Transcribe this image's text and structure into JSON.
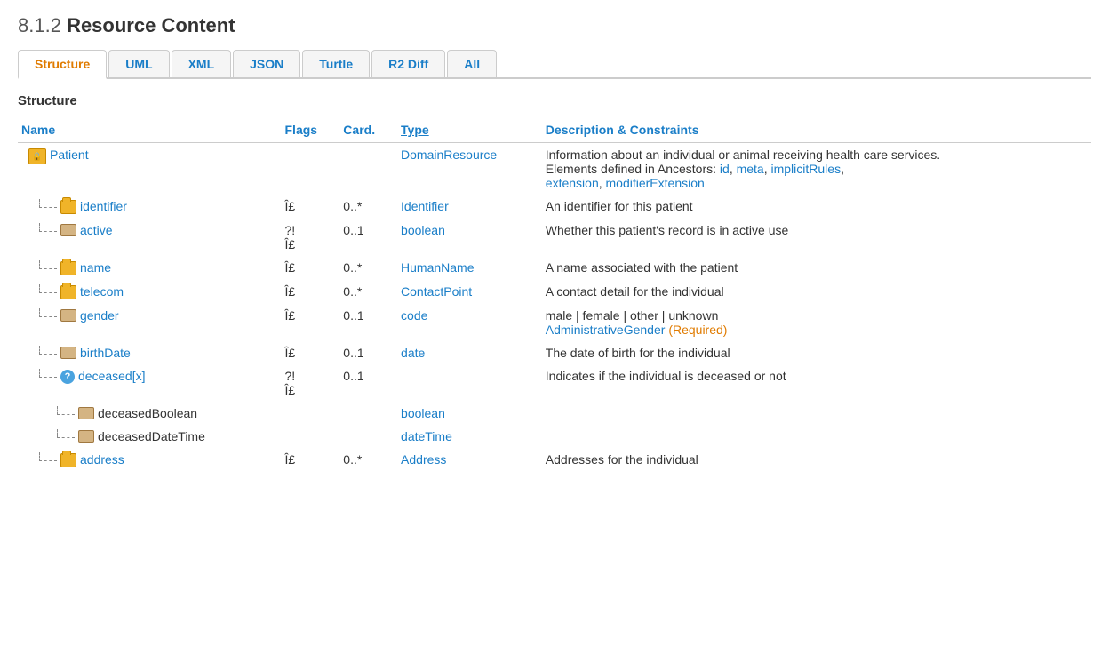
{
  "page": {
    "heading_num": "8.1.2",
    "heading_text": "Resource Content",
    "section_label": "Structure"
  },
  "tabs": [
    {
      "id": "structure",
      "label": "Structure",
      "active": true
    },
    {
      "id": "uml",
      "label": "UML",
      "active": false
    },
    {
      "id": "xml",
      "label": "XML",
      "active": false
    },
    {
      "id": "json",
      "label": "JSON",
      "active": false
    },
    {
      "id": "turtle",
      "label": "Turtle",
      "active": false
    },
    {
      "id": "r2diff",
      "label": "R2 Diff",
      "active": false
    },
    {
      "id": "all",
      "label": "All",
      "active": false
    }
  ],
  "table": {
    "columns": {
      "name": "Name",
      "flags": "Flags",
      "card": "Card.",
      "type": "Type",
      "desc": "Description & Constraints"
    },
    "rows": [
      {
        "id": "patient",
        "indent": 0,
        "icon": "root-folder",
        "name": "Patient",
        "flags": "",
        "card": "",
        "type": "DomainResource",
        "type_link": true,
        "desc": "Information about an individual or animal receiving health care services. Elements defined in Ancestors: ",
        "desc_links": [
          "id",
          "meta",
          "implicitRules",
          "extension",
          "modifierExtension"
        ],
        "desc_suffix": ""
      },
      {
        "id": "identifier",
        "indent": 1,
        "icon": "folder",
        "name": "identifier",
        "flags": "Î£",
        "card": "0..*",
        "type": "Identifier",
        "type_link": true,
        "desc": "An identifier for this patient"
      },
      {
        "id": "active",
        "indent": 1,
        "icon": "leaf",
        "name": "active",
        "flags": "?!\nÎ£",
        "card": "0..1",
        "type": "boolean",
        "type_link": true,
        "desc": "Whether this patient's record is in active use"
      },
      {
        "id": "name",
        "indent": 1,
        "icon": "folder",
        "name": "name",
        "flags": "Î£",
        "card": "0..*",
        "type": "HumanName",
        "type_link": true,
        "desc": "A name associated with the patient"
      },
      {
        "id": "telecom",
        "indent": 1,
        "icon": "folder",
        "name": "telecom",
        "flags": "Î£",
        "card": "0..*",
        "type": "ContactPoint",
        "type_link": true,
        "desc": "A contact detail for the individual"
      },
      {
        "id": "gender",
        "indent": 1,
        "icon": "leaf",
        "name": "gender",
        "flags": "Î£",
        "card": "0..1",
        "type": "code",
        "type_link": true,
        "desc": "male | female | other | unknown",
        "desc2": "AdministrativeGender",
        "desc2_link": true,
        "desc3": "(Required)"
      },
      {
        "id": "birthDate",
        "indent": 1,
        "icon": "leaf",
        "name": "birthDate",
        "flags": "Î£",
        "card": "0..1",
        "type": "date",
        "type_link": true,
        "desc": "The date of birth for the individual"
      },
      {
        "id": "deceased",
        "indent": 1,
        "icon": "question",
        "name": "deceased[x]",
        "flags": "?!\nÎ£",
        "card": "0..1",
        "type": "",
        "type_link": false,
        "desc": "Indicates if the individual is deceased or not"
      },
      {
        "id": "deceasedBoolean",
        "indent": 2,
        "icon": "leaf",
        "name": "deceasedBoolean",
        "flags": "",
        "card": "",
        "type": "boolean",
        "type_link": true,
        "desc": ""
      },
      {
        "id": "deceasedDateTime",
        "indent": 2,
        "icon": "leaf",
        "name": "deceasedDateTime",
        "flags": "",
        "card": "",
        "type": "dateTime",
        "type_link": true,
        "desc": ""
      },
      {
        "id": "address",
        "indent": 1,
        "icon": "folder",
        "name": "address",
        "flags": "Î£",
        "card": "0..*",
        "type": "Address",
        "type_link": true,
        "desc": "Addresses for the individual"
      }
    ]
  },
  "colors": {
    "accent": "#1a7ec8",
    "tab_active": "#e07b00",
    "link": "#1a7ec8",
    "required": "#e07b00"
  }
}
